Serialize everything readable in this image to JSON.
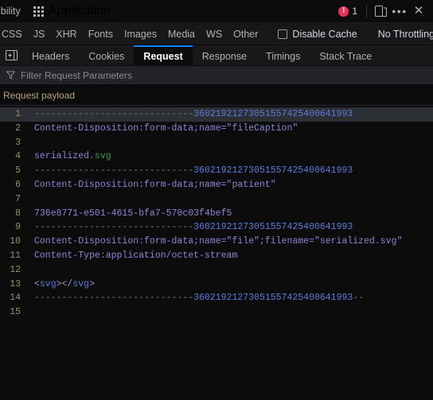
{
  "toolbar": {
    "left_tab_truncated": "ibility",
    "app_tab": {
      "label": "Application",
      "icon": "grid-icon"
    },
    "error_badge": {
      "icon": "error-circle-icon",
      "glyph": "!",
      "count": "1"
    },
    "responsive_icon": "responsive-design-mode-icon",
    "meatball_icon": "more-options-icon",
    "close_icon": "close-icon"
  },
  "filters": {
    "types": [
      "CSS",
      "JS",
      "XHR",
      "Fonts",
      "Images",
      "Media",
      "WS",
      "Other"
    ],
    "disable_cache": {
      "label": "Disable Cache",
      "checked": false
    },
    "throttling": {
      "value": "No Throttling",
      "icon": "chevron-updown-icon"
    },
    "settings_icon": "gear-icon"
  },
  "detail_panel": {
    "toggle_icon": "panel-toggle-icon",
    "tabs": [
      {
        "label": "Headers",
        "active": false
      },
      {
        "label": "Cookies",
        "active": false
      },
      {
        "label": "Request",
        "active": true
      },
      {
        "label": "Response",
        "active": false
      },
      {
        "label": "Timings",
        "active": false
      },
      {
        "label": "Stack Trace",
        "active": false
      }
    ],
    "filter": {
      "icon": "funnel-icon",
      "placeholder": "Filter Request Parameters",
      "value": ""
    },
    "section_title": "Request payload"
  },
  "payload": {
    "boundary": "-----------------------------3602192127305155742540064 1993",
    "lines": [
      {
        "n": "1",
        "highlight": true,
        "segments": [
          {
            "t": "-----------------------------",
            "c": "c-dash"
          },
          {
            "t": "3602192127305155742540064 1993",
            "c": "c-num"
          }
        ]
      },
      {
        "n": "2",
        "highlight": false,
        "segments": [
          {
            "t": "Content-Disposition: form-data; name=\"fileCaption\"",
            "c": "c-txt"
          }
        ]
      },
      {
        "n": "3",
        "highlight": false,
        "segments": [
          {
            "t": "",
            "c": "c-txt"
          }
        ]
      },
      {
        "n": "4",
        "highlight": false,
        "segments": [
          {
            "t": "serialized",
            "c": "c-txt"
          },
          {
            "t": ".svg",
            "c": "c-grn"
          }
        ]
      },
      {
        "n": "5",
        "highlight": false,
        "segments": [
          {
            "t": "-----------------------------",
            "c": "c-dash"
          },
          {
            "t": "3602192127305155742540064 1993",
            "c": "c-num"
          }
        ]
      },
      {
        "n": "6",
        "highlight": false,
        "segments": [
          {
            "t": "Content-Disposition: form-data; name=\"patient\"",
            "c": "c-txt"
          }
        ]
      },
      {
        "n": "7",
        "highlight": false,
        "segments": [
          {
            "t": "",
            "c": "c-txt"
          }
        ]
      },
      {
        "n": "8",
        "highlight": false,
        "segments": [
          {
            "t": "736e8771-e501-4615-bfa7-570c03f4bef5",
            "c": "c-txt"
          }
        ]
      },
      {
        "n": "9",
        "highlight": false,
        "segments": [
          {
            "t": "-----------------------------",
            "c": "c-dash"
          },
          {
            "t": "3602192127305155742540064 1993",
            "c": "c-num"
          }
        ]
      },
      {
        "n": "10",
        "highlight": false,
        "segments": [
          {
            "t": "Content-Disposition: form-data; name=\"file\"; filename=\"serialized.svg\"",
            "c": "c-txt"
          }
        ]
      },
      {
        "n": "11",
        "highlight": false,
        "segments": [
          {
            "t": "Content-Type: application/octet-stream",
            "c": "c-txt"
          }
        ]
      },
      {
        "n": "12",
        "highlight": false,
        "segments": [
          {
            "t": "",
            "c": "c-txt"
          }
        ]
      },
      {
        "n": "13",
        "highlight": false,
        "segments": [
          {
            "t": "<",
            "c": "c-tag"
          },
          {
            "t": "svg",
            "c": "c-num"
          },
          {
            "t": "></",
            "c": "c-tag"
          },
          {
            "t": "svg",
            "c": "c-num"
          },
          {
            "t": ">",
            "c": "c-tag"
          }
        ]
      },
      {
        "n": "14",
        "highlight": false,
        "segments": [
          {
            "t": "-----------------------------",
            "c": "c-dash"
          },
          {
            "t": "3602192127305155742540064 1993",
            "c": "c-num"
          },
          {
            "t": "--",
            "c": "c-dash"
          }
        ]
      },
      {
        "n": "15",
        "highlight": false,
        "segments": [
          {
            "t": "",
            "c": "c-txt"
          }
        ]
      }
    ]
  },
  "colors": {
    "accent_blue": "#0a84ff",
    "error_red": "#e8335c",
    "bg": "#0c0c0d",
    "toolbar_bg": "#18181a",
    "filter_bg": "#232327",
    "gutter_text": "#939357",
    "code_blue": "#5a7cdb",
    "code_purple": "#8a86d6",
    "code_green": "#3d9a50",
    "highlight_row": "#2c3034"
  }
}
